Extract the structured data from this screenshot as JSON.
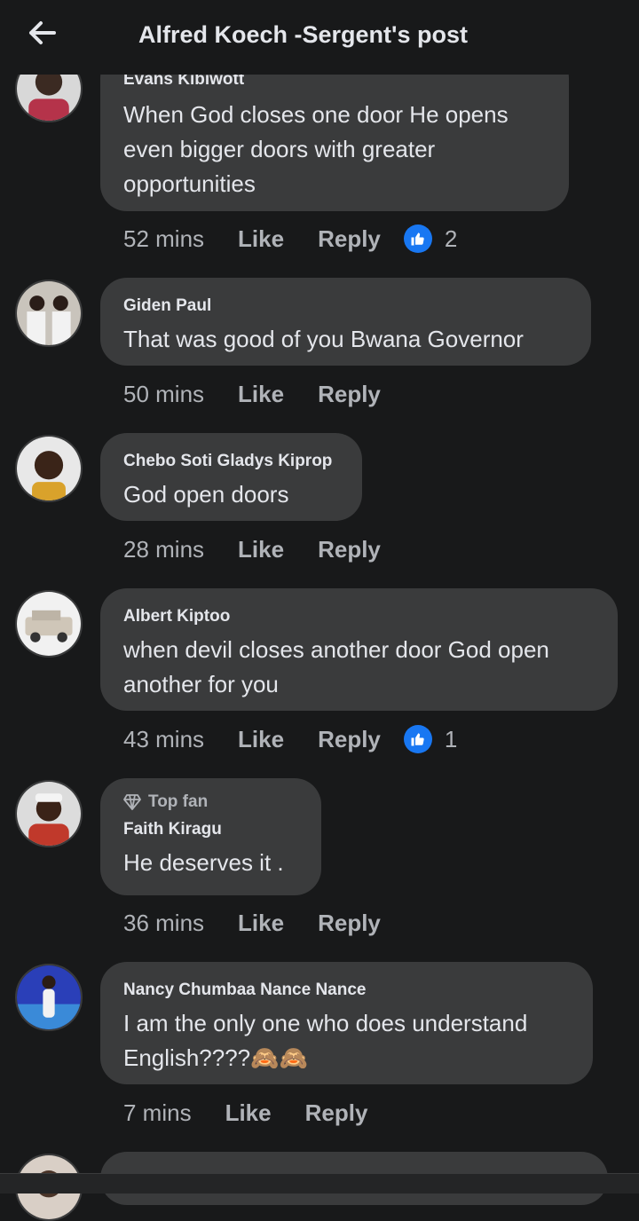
{
  "header": {
    "title": "Alfred Koech -Sergent's post",
    "back_icon": "arrow-left-icon"
  },
  "comments": [
    {
      "name": "Evans Kibiwott",
      "lines": [
        "When God closes one door He opens",
        "even bigger doors  with greater",
        "opportunities"
      ],
      "time": "52 mins",
      "like": "Like",
      "reply": "Reply",
      "reactions": "2"
    },
    {
      "name": "Giden Paul",
      "lines": [
        "That was good of you Bwana Governor"
      ],
      "time": "50 mins",
      "like": "Like",
      "reply": "Reply"
    },
    {
      "name": "Chebo Soti Gladys Kiprop",
      "lines": [
        "God open doors"
      ],
      "time": "28 mins",
      "like": "Like",
      "reply": "Reply"
    },
    {
      "name": "Albert Kiptoo",
      "lines": [
        "when devil closes another door God open",
        "another for you"
      ],
      "time": "43 mins",
      "like": "Like",
      "reply": "Reply",
      "reactions": "1"
    },
    {
      "badge": "Top fan",
      "name": "Faith Kiragu",
      "lines": [
        "He deserves it ."
      ],
      "time": "36 mins",
      "like": "Like",
      "reply": "Reply"
    },
    {
      "name": "Nancy Chumbaa Nance Nance",
      "lines": [
        "I am the only one who does understand",
        "English????🙈🙈"
      ],
      "time": "7 mins",
      "like": "Like",
      "reply": "Reply"
    }
  ],
  "colors": {
    "background": "#18191a",
    "bubble": "#3a3b3c",
    "like_blue": "#1877f2",
    "muted_text": "#b0b3b8"
  }
}
